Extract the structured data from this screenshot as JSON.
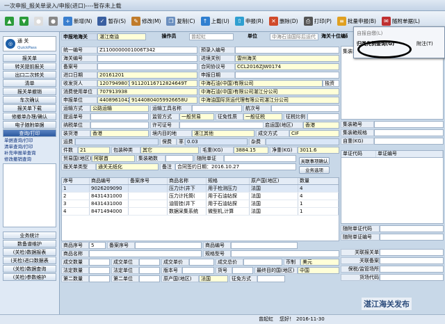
{
  "window": {
    "title": "一次申报_报关单录入/申报(进口)----暂存未上载"
  },
  "toolbar": [
    {
      "icon": "arrow-up-icon",
      "label": "",
      "color": "#2b9b3a"
    },
    {
      "icon": "arrow-down-icon",
      "label": "",
      "color": "#2b9b3a"
    },
    {
      "icon": "circle-icon",
      "label": "",
      "color": "#ddd"
    },
    {
      "icon": "circle-dark-icon",
      "label": "",
      "color": "#888"
    },
    {
      "icon": "new-icon",
      "label": "新增(N)",
      "color": "#3a7fcf"
    },
    {
      "icon": "save-icon",
      "label": "暂存(S)",
      "color": "#3a5fa0"
    },
    {
      "icon": "edit-icon",
      "label": "修改(M)",
      "color": "#c07b2a"
    },
    {
      "icon": "copy-icon",
      "label": "复制(C)",
      "color": "#6b8fbf"
    },
    {
      "icon": "upload-icon",
      "label": "上载(U)",
      "color": "#2f7fd0"
    },
    {
      "icon": "declare-icon",
      "label": "申报(R)",
      "color": "#2f9fd0"
    },
    {
      "icon": "delete-icon",
      "label": "删除(D)",
      "color": "#d04a2a"
    },
    {
      "icon": "print-icon",
      "label": "打印(P)",
      "color": "#555"
    },
    {
      "icon": "batch-icon",
      "label": "批量申报(B)",
      "color": "#e0a020"
    },
    {
      "icon": "attach-icon",
      "label": "随附单据(L)",
      "color": "#c03030"
    }
  ],
  "dropdown": {
    "items": [
      "自报自缴(L)",
      "归类先例查询(G)"
    ],
    "right_label": "附注(T)"
  },
  "sidebar": {
    "logo_name": "通  关",
    "logo_sub": "QuickPass",
    "items": [
      "报关单",
      "转关提前报关",
      "出口二次转关",
      "清单",
      "报关单撤销",
      "车次确认",
      "报关单下载",
      "修撤单办理/确认",
      "电子随附单据",
      "查询/打印"
    ],
    "subitems": [
      "单据查询/打印",
      "清单查询/打印",
      "补充申报单查询",
      "修改撤销查询"
    ],
    "bottom": [
      "业务统计",
      "数备谱维护",
      "(关检)数据报表",
      "(关检)进口数据表",
      "(关检)数据查询",
      "(关检)参数维护"
    ]
  },
  "header": {
    "decl_port_label": "申报地海关",
    "decl_port_value": "湛江南油",
    "operator_label": "操作员",
    "operator_value": "曾起虹",
    "unit_label": "单位",
    "unit_value": "中海石油国际后运代",
    "position_label": "海关十位编码"
  },
  "form": {
    "r1": {
      "l1": "统一编号",
      "v1": "Z1100000001006T342",
      "l2": "预录入编号"
    },
    "r2": {
      "l1": "海关编号",
      "v1": "",
      "l2": "进境关别",
      "v2": "雷州海关"
    },
    "r3": {
      "l1": "备案号",
      "v1": "",
      "l2": "合同协议号",
      "v2": "CCL2016ZJW0174"
    },
    "r4": {
      "l1": "进口日期",
      "v1": "20161201",
      "l2": "申报日期"
    },
    "r5": {
      "l1": "收发货人",
      "v1": "1207949807",
      "v2": "91120116712824649T",
      "v3": "中海石油(中国)有限公司",
      "v4": "独资"
    },
    "r6": {
      "l1": "消费使用单位",
      "v1": "707913938",
      "v3": "中海石油(中国)有限公司湛江分公司"
    },
    "r7": {
      "l1": "申报单位",
      "v1": "4408961042",
      "v2": "91440804059926658U",
      "v3": "中海油国际货运代理有限公司湛江分公司"
    },
    "r8": {
      "l1": "运输方式",
      "v1": "公路运输",
      "l2": "运输工具名称",
      "l3": "航次号"
    },
    "r9": {
      "l1": "提运单号",
      "l2": "监管方式",
      "v2": "一般贸易",
      "l3": "征免性质",
      "v3": "一般征税",
      "l4": "征税比例"
    },
    "r10": {
      "l1": "纳税单位",
      "l2": "许可证号",
      "l3": "启运国(地区)",
      "v3": "香港"
    },
    "r11": {
      "l1": "装货港",
      "v1": "香港",
      "l2": "境内目的地",
      "v2": "湛江其他",
      "l3": "成交方式",
      "v3": "CIF"
    },
    "r12": {
      "l1": "运费",
      "l2": "保费",
      "l2b": "率",
      "v2": "0.03",
      "l3": "杂费"
    },
    "r13": {
      "l1": "件数",
      "v1": "21",
      "l2": "包装种类",
      "v2": "其它",
      "l3": "毛重(KG)",
      "v3": "3884.15",
      "l4": "净重(KG)",
      "v4": "3011.6"
    },
    "r14": {
      "l1": "贸易国(地区)",
      "v1": "阿联酋",
      "l2": "集装箱数",
      "l3": "随附单证",
      "btn": "关联事项确认"
    },
    "r15": {
      "l1": "报关单类型",
      "v1": "通关无纸化",
      "l2": "备注",
      "v2": "合同签约日期：2016.10.27",
      "btn": "业务选项"
    }
  },
  "goods_table": {
    "headers": [
      "序号",
      "商品编号",
      "备案序号",
      "商品名称",
      "规格",
      "原产国(地区)",
      "数量"
    ],
    "rows": [
      [
        "1",
        "9026209090",
        "",
        "压力计(井下",
        "用于检测压力",
        "法国",
        "4"
      ],
      [
        "2",
        "8431431000",
        "",
        "压力计托筒(",
        "用于石油钻探",
        "法国",
        "4"
      ],
      [
        "3",
        "8431431000",
        "",
        "油管挂(井下",
        "用于石油钻探",
        "法国",
        "1"
      ],
      [
        "4",
        "8471494000",
        "",
        "数据采集系统",
        "微型机,计算",
        "法国",
        "1"
      ]
    ]
  },
  "goods_form": {
    "l1": "商品序号",
    "v1": "5",
    "l2": "备案序号",
    "l3": "商品编号",
    "l4": "商品名称",
    "l5": "规格型号",
    "l6": "成交数量",
    "l7": "成交单位",
    "l8": "成交单价",
    "l9": "成交总价",
    "l10": "币制",
    "v10": "美元",
    "l11": "法定数量",
    "l12": "法定单位",
    "l13": "版本号",
    "l14": "货号",
    "l15": "最终目的国(地区)",
    "v15": "中国",
    "l16": "第二数量",
    "l17": "第二单位",
    "l18": "原产国(地区)",
    "v18": "法国",
    "l19": "征免方式"
  },
  "right": {
    "container_label": "集装箱",
    "fields": [
      "集装箱号",
      "集装箱规格",
      "自重(KG)"
    ],
    "docs_headers": [
      "单证代码",
      "单证编号"
    ],
    "docs_fields": [
      "随附单证代码",
      "随附单证编号"
    ],
    "related": [
      "关联报关单",
      "关联备案",
      "保税/监管场所",
      "货场代码"
    ]
  },
  "status": {
    "user": "曾起虹",
    "greeting": "您好！",
    "date": "2016-11-30"
  },
  "watermark": "湛江海关发布"
}
